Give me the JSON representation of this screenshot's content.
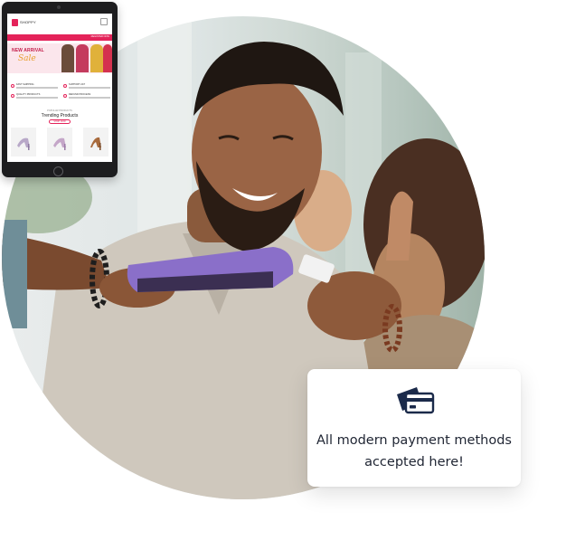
{
  "tablet": {
    "brand_name": "SHOPPY",
    "nav_button": "REGISTER NOW",
    "banner": {
      "heading": "NEW ARRIVAL",
      "script_text": "Sale"
    },
    "features": [
      {
        "title": "FAST SHIPPING"
      },
      {
        "title": "SUPPORT 24/7"
      },
      {
        "title": "QUALITY PRODUCTS"
      },
      {
        "title": "REFUND PROCESS"
      }
    ],
    "section_kicker": "POPULAR PRODUCTS",
    "section_title": "Trending Products",
    "section_button": "SHOP NOW"
  },
  "payment_card": {
    "icon": "credit-card-icon",
    "line1": "All modern payment methods",
    "line2": "accepted here!"
  },
  "colors": {
    "brand_pink": "#e4235a",
    "card_navy": "#1b2a4a",
    "terminal_purple": "#8a6fc9"
  }
}
